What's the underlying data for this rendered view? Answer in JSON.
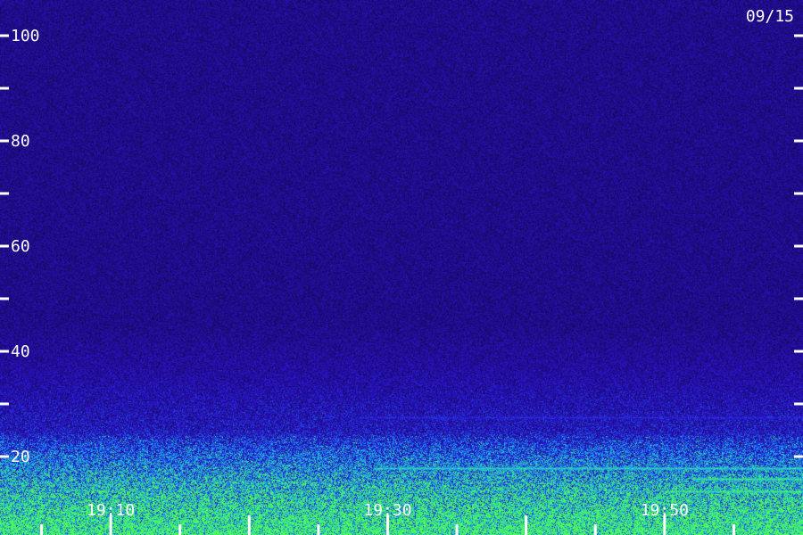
{
  "chart_data": {
    "type": "heatmap",
    "title": "",
    "date": "09/15",
    "xlabel": "",
    "ylabel": "",
    "y_ticks": [
      20,
      30,
      40,
      50,
      60,
      70,
      80,
      90,
      100
    ],
    "y_tick_labels": [
      "20",
      "40",
      "60",
      "80",
      "100"
    ],
    "y_tick_label_values": [
      20,
      40,
      60,
      80,
      100
    ],
    "ylim": [
      12,
      105
    ],
    "x_tick_labels": [
      "19:10",
      "19:30",
      "19:50"
    ],
    "x_tick_label_times": [
      "19:10",
      "19:30",
      "19:50"
    ],
    "xlim": [
      "19:02",
      "20:00"
    ],
    "major_x_ticks": [
      "19:10",
      "19:20",
      "19:30",
      "19:40",
      "19:50"
    ],
    "minor_x_ticks": [
      "19:05",
      "19:15",
      "19:25",
      "19:35",
      "19:45",
      "19:55"
    ],
    "background_color": "#1a0a6e",
    "strong_signal_color": "#33ff66",
    "mid_signal_color": "#2ad4ff",
    "low_signal_color": "#1f3bd6",
    "tick_color": "#ffffff",
    "bands": [
      {
        "value": 17.8,
        "start": "19:29",
        "intensity": 0.9
      },
      {
        "value": 15.0,
        "start": "19:02",
        "intensity": 0.55
      },
      {
        "value": 13.6,
        "start": "19:02",
        "intensity": 0.6
      },
      {
        "value": 13.4,
        "start": "19:50",
        "intensity": 1.0
      },
      {
        "value": 15.8,
        "start": "19:52",
        "intensity": 1.0
      },
      {
        "value": 27.5,
        "start": "19:28",
        "intensity": 0.45
      }
    ]
  }
}
